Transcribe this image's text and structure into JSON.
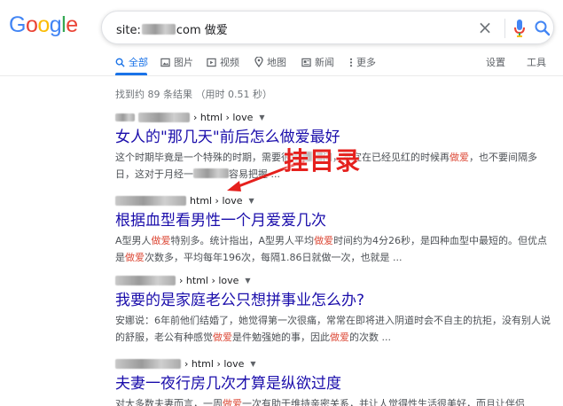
{
  "logo": {
    "letters": [
      "G",
      "o",
      "o",
      "g",
      "l",
      "e"
    ],
    "colors": [
      "#4285f4",
      "#ea4335",
      "#fbbc05",
      "#4285f4",
      "#34a853",
      "#ea4335"
    ]
  },
  "search": {
    "query_prefix": "site:",
    "query_suffix": "com 做爱",
    "clear_glyph": "×"
  },
  "tabs": [
    {
      "label": "全部",
      "icon": "search-icon",
      "active": true
    },
    {
      "label": "图片",
      "icon": "image-icon",
      "active": false
    },
    {
      "label": "视频",
      "icon": "video-icon",
      "active": false
    },
    {
      "label": "地图",
      "icon": "map-pin-icon",
      "active": false
    },
    {
      "label": "新闻",
      "icon": "news-icon",
      "active": false
    },
    {
      "label": "更多",
      "icon": "more-vert-icon",
      "active": false
    }
  ],
  "tools": {
    "settings": "设置",
    "tools": "工具"
  },
  "stats": "找到约 89 条结果 （用时 0.51 秒）",
  "results": [
    {
      "crumb_path": "› html › love",
      "title": "女人的\"那几天\"前后怎么做爱最好",
      "snippet": [
        {
          "t": "这个时期毕竟是一个特殊的时期，需要很"
        },
        {
          "t": ""
        },
        {
          "t": "问，不宜在已经见红的时候再"
        },
        {
          "t": "做爱",
          "hl": true
        },
        {
          "t": "，也不要间隔多日，这对于月经一"
        },
        {
          "t": ""
        },
        {
          "t": "容易把握 ..."
        }
      ]
    },
    {
      "crumb_path": "html › love",
      "title": "根据血型看男性一个月爱爱几次",
      "snippet": [
        {
          "t": "A型男人"
        },
        {
          "t": "做爱",
          "hl": true
        },
        {
          "t": "特别多。统计指出，A型男人平均"
        },
        {
          "t": "做爱",
          "hl": true
        },
        {
          "t": "时间约为4分26秒，是四种血型中最短的。但优点是"
        },
        {
          "t": "做爱",
          "hl": true
        },
        {
          "t": "次数多，平均每年196次，每隔1.86日就做一次，也就是 ..."
        }
      ]
    },
    {
      "crumb_path": "› html › love",
      "title": "我要的是家庭老公只想拼事业怎么办?",
      "snippet": [
        {
          "t": "安娜说：6年前他们结婚了，她觉得第一次很痛，常常在即将进入阴道时会不自主的抗拒，没有别人说的舒服，老公有种感觉"
        },
        {
          "t": "做爱",
          "hl": true
        },
        {
          "t": "是件勉强她的事，因此"
        },
        {
          "t": "做爱",
          "hl": true
        },
        {
          "t": "的次数 ..."
        }
      ]
    },
    {
      "crumb_path": "› html › love",
      "title": "夫妻一夜行房几次才算是纵欲过度",
      "snippet": [
        {
          "t": "对大多数夫妻而言，一周"
        },
        {
          "t": "做爱",
          "hl": true
        },
        {
          "t": "一次有助于维持亲密关系，并让人觉得性生活很美好，而且让伴侣"
        }
      ]
    }
  ],
  "annotation": {
    "label": "挂目录",
    "color": "#e5201d"
  }
}
